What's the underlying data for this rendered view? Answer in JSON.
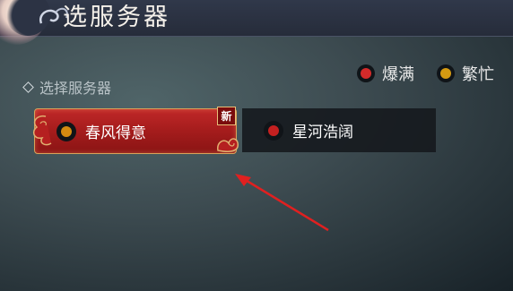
{
  "header": {
    "title": "选服务器"
  },
  "legend": [
    {
      "label": "爆满",
      "color": "#d42a2a"
    },
    {
      "label": "繁忙",
      "color": "#d49a12"
    }
  ],
  "section": {
    "label": "选择服务器"
  },
  "servers": [
    {
      "name": "春风得意",
      "status_color": "#d48a10",
      "badge": "新",
      "selected": true
    },
    {
      "name": "星河浩阔",
      "status_color": "#c42020",
      "selected": false
    }
  ]
}
